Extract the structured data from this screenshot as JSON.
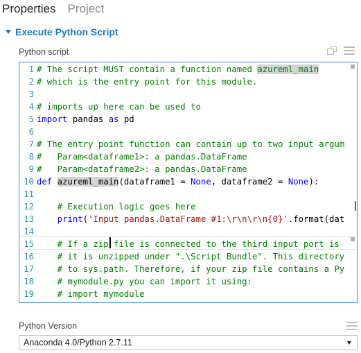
{
  "tabs": [
    {
      "label": "Properties"
    },
    {
      "label": "Project"
    }
  ],
  "section": {
    "title": "Execute Python Script"
  },
  "script_field": {
    "label": "Python script"
  },
  "code_lines": [
    {
      "n": "1",
      "parts": [
        {
          "t": "# The script MUST contain a function named ",
          "c": "cm"
        },
        {
          "t": "azureml_main",
          "c": "cm hl-word"
        }
      ]
    },
    {
      "n": "2",
      "parts": [
        {
          "t": "# which is the entry point for this module.",
          "c": "cm"
        }
      ]
    },
    {
      "n": "3",
      "parts": []
    },
    {
      "n": "4",
      "parts": [
        {
          "t": "# imports up here can be used to",
          "c": "cm"
        }
      ]
    },
    {
      "n": "5",
      "parts": [
        {
          "t": "import",
          "c": "kw"
        },
        {
          "t": " pandas ",
          "c": "tx"
        },
        {
          "t": "as",
          "c": "kw"
        },
        {
          "t": " pd",
          "c": "tx"
        }
      ]
    },
    {
      "n": "6",
      "parts": []
    },
    {
      "n": "7",
      "parts": [
        {
          "t": "# The entry point function can contain up to two input argum",
          "c": "cm"
        }
      ]
    },
    {
      "n": "8",
      "parts": [
        {
          "t": "#   Param<dataframe1>: a pandas.DataFrame",
          "c": "cm"
        }
      ]
    },
    {
      "n": "9",
      "parts": [
        {
          "t": "#   Param<dataframe2>: a pandas.DataFrame",
          "c": "cm"
        }
      ]
    },
    {
      "n": "10",
      "parts": [
        {
          "t": "def",
          "c": "kw"
        },
        {
          "t": " ",
          "c": "tx"
        },
        {
          "t": "azureml_main",
          "c": "tx hl-word"
        },
        {
          "t": "(dataframe1 = ",
          "c": "tx"
        },
        {
          "t": "None",
          "c": "kw"
        },
        {
          "t": ", dataframe2 = ",
          "c": "tx"
        },
        {
          "t": "None",
          "c": "kw"
        },
        {
          "t": "):",
          "c": "tx"
        }
      ]
    },
    {
      "n": "11",
      "parts": []
    },
    {
      "n": "12",
      "parts": [
        {
          "t": "    # Execution logic goes here",
          "c": "cm"
        }
      ]
    },
    {
      "n": "13",
      "parts": [
        {
          "t": "    ",
          "c": "tx"
        },
        {
          "t": "print",
          "c": "kw"
        },
        {
          "t": "(",
          "c": "tx"
        },
        {
          "t": "'Input pandas.DataFrame #1:\\r\\n\\r\\n{0}'",
          "c": "st"
        },
        {
          "t": ".format(dat",
          "c": "tx"
        }
      ]
    },
    {
      "n": "14",
      "parts": []
    },
    {
      "n": "15",
      "parts": [
        {
          "t": "    # If a zip file is connected to the third input port is",
          "c": "cm"
        }
      ]
    },
    {
      "n": "16",
      "parts": [
        {
          "t": "    # it is unzipped under \".\\Script Bundle\". This directory",
          "c": "cm"
        }
      ]
    },
    {
      "n": "17",
      "parts": [
        {
          "t": "    # to sys.path. Therefore, if your zip file contains a Py",
          "c": "cm"
        }
      ]
    },
    {
      "n": "18",
      "parts": [
        {
          "t": "    # mymodule.py you can import it using:",
          "c": "cm"
        }
      ]
    },
    {
      "n": "19",
      "parts": [
        {
          "t": "    # import mymodule",
          "c": "cm"
        }
      ]
    }
  ],
  "version_field": {
    "label": "Python Version",
    "selected": "Anaconda 4.0/Python 2.7.11"
  },
  "icons": {
    "popout": "popout-icon",
    "menu": "hamburger-menu-icon",
    "collapse": "caret-down-icon",
    "dropdown": "chevron-down-icon"
  },
  "colors": {
    "accent": "#1e7bc0",
    "comment": "#008000",
    "keyword": "#0000ff",
    "string": "#a31515",
    "line_number": "#2b91af"
  }
}
